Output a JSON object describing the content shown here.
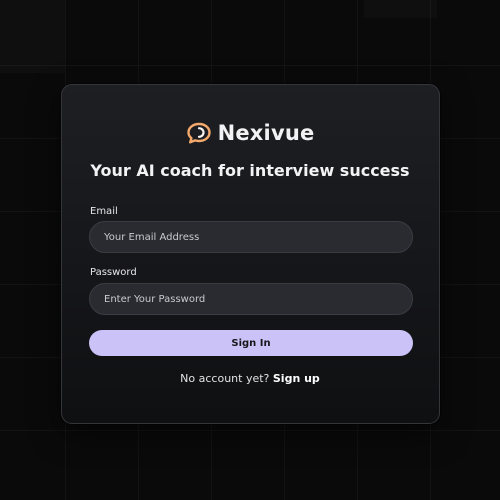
{
  "brand": {
    "name": "Nexivue",
    "icon": "chat-bubble-icon"
  },
  "tagline": "Your AI coach for interview success",
  "form": {
    "email": {
      "label": "Email",
      "placeholder": "Your Email Address",
      "value": ""
    },
    "password": {
      "label": "Password",
      "placeholder": "Enter Your Password",
      "value": ""
    },
    "submit_label": "Sign In"
  },
  "footer": {
    "prompt": "No account yet?",
    "link_label": "Sign up"
  },
  "colors": {
    "accent": "#cbc3f7",
    "brand_icon": "#f2a96b",
    "card_bg": "#16171a",
    "page_bg": "#0a0a0b",
    "input_bg": "#2a2b30"
  }
}
